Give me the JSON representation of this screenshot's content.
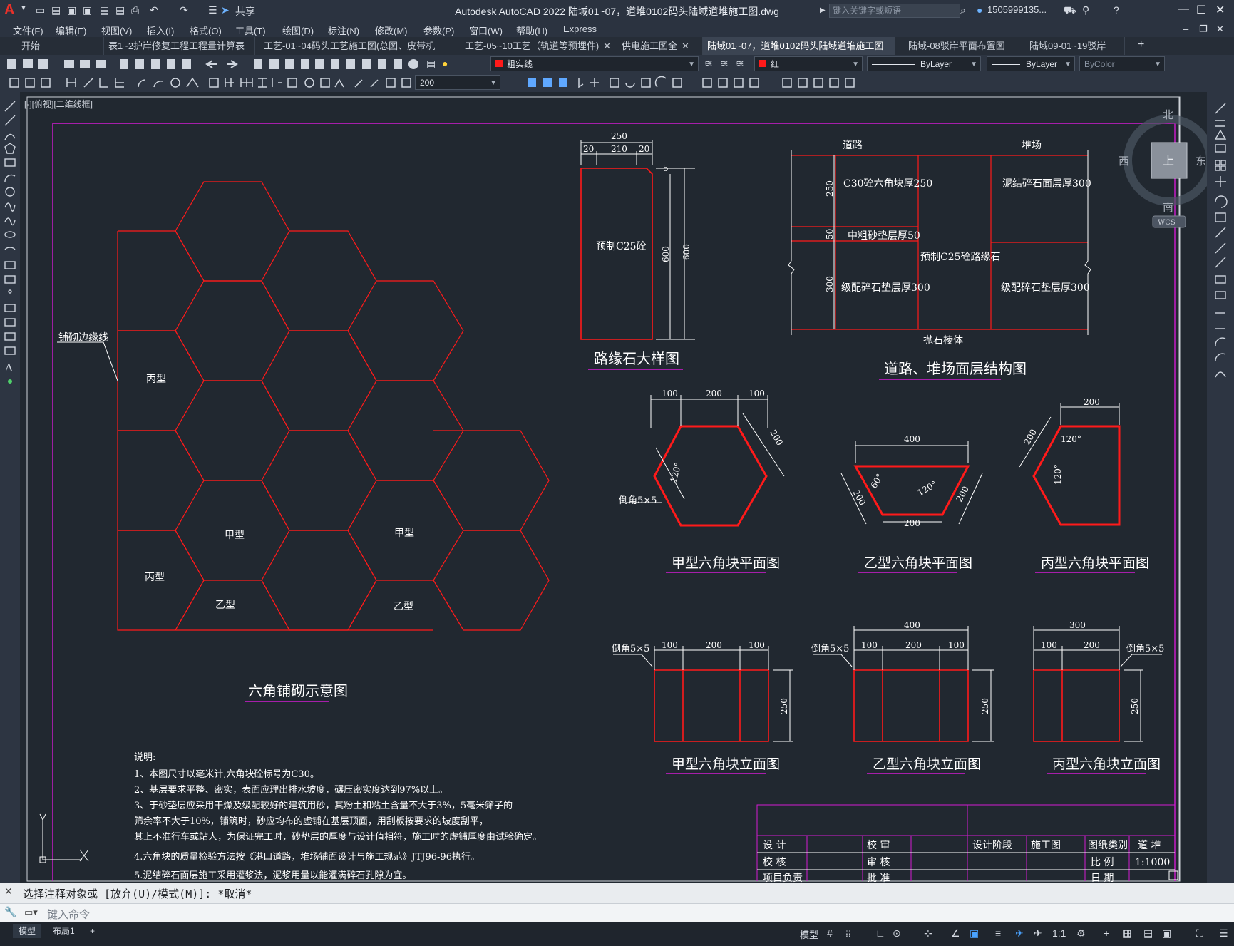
{
  "app": {
    "title": "Autodesk AutoCAD 2022    陆域01~07，道堆0102码头陆域道堆施工图.dwg",
    "share_label": "共享",
    "search_placeholder": "键入关键字或短语",
    "user": "1505999135...",
    "help": "?"
  },
  "menu": [
    "文件(F)",
    "编辑(E)",
    "视图(V)",
    "插入(I)",
    "格式(O)",
    "工具(T)",
    "绘图(D)",
    "标注(N)",
    "修改(M)",
    "参数(P)",
    "窗口(W)",
    "帮助(H)",
    "Express"
  ],
  "tabs": [
    {
      "label": "开始",
      "active": false,
      "closable": false
    },
    {
      "label": "表1~2护岸修复工程工程量计算表",
      "active": false,
      "closable": true
    },
    {
      "label": "工艺-01~04码头工艺施工图(总图、皮带机2)",
      "active": false,
      "closable": true
    },
    {
      "label": "工艺-05~10工艺（轨道等预埋件)",
      "active": false,
      "closable": true
    },
    {
      "label": "供电施工图全",
      "active": false,
      "closable": true
    },
    {
      "label": "陆域01~07，道堆0102码头陆域道堆施工图*",
      "active": true,
      "closable": true
    },
    {
      "label": "陆域-08驳岸平面布置图*",
      "active": false,
      "closable": true
    },
    {
      "label": "陆域09-01~19驳岸*",
      "active": false,
      "closable": true
    }
  ],
  "toolbar": {
    "layer_name": "粗实线",
    "color_name": "红",
    "linetype": "ByLayer",
    "lineweight": "ByLayer",
    "plotstyle": "ByColor",
    "dim_scale": "200"
  },
  "viewport_label": "[-][俯视][二维线框]",
  "viewcube": {
    "north": "北",
    "south": "南",
    "east": "东",
    "west": "西",
    "top": "上",
    "wcs": "WCS"
  },
  "drawing": {
    "hex_title": "六角铺砌示意图",
    "edge_label": "铺砌边缘线",
    "hex_labels": {
      "jia": "甲型",
      "yi": "乙型",
      "bing": "丙型"
    },
    "curb_title": "路缘石大样图",
    "curb_label": "预制C25砼",
    "curb_dims": {
      "top": "250",
      "l": "20",
      "m": "210",
      "r": "20",
      "h1": "600",
      "h2": "600",
      "c": "5"
    },
    "road_title": "道路、堆场面层结构图",
    "road_headers": {
      "road": "道路",
      "yard": "堆场"
    },
    "road_layers": {
      "l1": "C30砼六角块厚250",
      "l2": "中粗砂垫层厚50",
      "l3": "级配碎石垫层厚300",
      "mid": "预制C25砼路缘石",
      "r1": "泥结碎石面层厚300",
      "r2": "级配碎石垫层厚300",
      "bottom": "抛石棱体"
    },
    "road_dims": {
      "d1": "250",
      "d2": "50",
      "d3": "300"
    },
    "plan_titles": {
      "jia": "甲型六角块平面图",
      "yi": "乙型六角块平面图",
      "bing": "丙型六角块平面图"
    },
    "elev_titles": {
      "jia": "甲型六角块立面图",
      "yi": "乙型六角块立面图",
      "bing": "丙型六角块立面图"
    },
    "dims": {
      "d100": "100",
      "d200": "200",
      "d300": "300",
      "d400": "400",
      "d250": "250",
      "a120": "120°",
      "a60": "60°",
      "chamfer": "倒角5×5"
    },
    "notes_title": "说明:",
    "notes": [
      "1、本图尺寸以毫米计,六角块砼标号为C30。",
      "2、基层要求平整、密实，表面应理出排水坡度，碾压密实度达到97%以上。",
      "3、于砂垫层应采用干燥及级配较好的建筑用砂，其粉土和粘土含量不大于3%，5毫米筛子的",
      "   筛余率不大于10%，铺筑时，砂应均布的虚铺在基层顶面，用刮板按要求的坡度刮平，",
      "   其上不准行车或站人，为保证完工时，砂垫层的厚度与设计值相符，施工时的虚铺厚度由试验确定。",
      "4.六角块的质量检验方法按《港口道路，堆场铺面设计与施工规范》JTJ96-96执行。",
      "5.泥结碎石面层施工采用灌浆法，泥浆用量以能灌满碎石孔隙为宜。"
    ],
    "title_block": {
      "design": "设 计",
      "check": "校 审",
      "check2": "校 核",
      "review": "审 核",
      "stage_label": "设计阶段",
      "stage": "施工图",
      "type_label": "图纸类别",
      "type": "道 堆",
      "scale_label": "比 例",
      "scale": "1:1000",
      "date_label": "日 期",
      "approve": "批 准",
      "lead": "项目负责"
    }
  },
  "command": {
    "history": "选择注释对象或 [放弃(U)/模式(M)]: *取消*",
    "placeholder": "键入命令"
  },
  "status": {
    "model_tab": "模型",
    "layout_tab": "布局1",
    "add_tab": "+",
    "mode": "模型",
    "scale": "1:1"
  },
  "colors": {
    "accent": "#e8312a",
    "drawing_red": "#ff1a1a",
    "frame": "#d21bd2",
    "line": "#ffffff"
  }
}
